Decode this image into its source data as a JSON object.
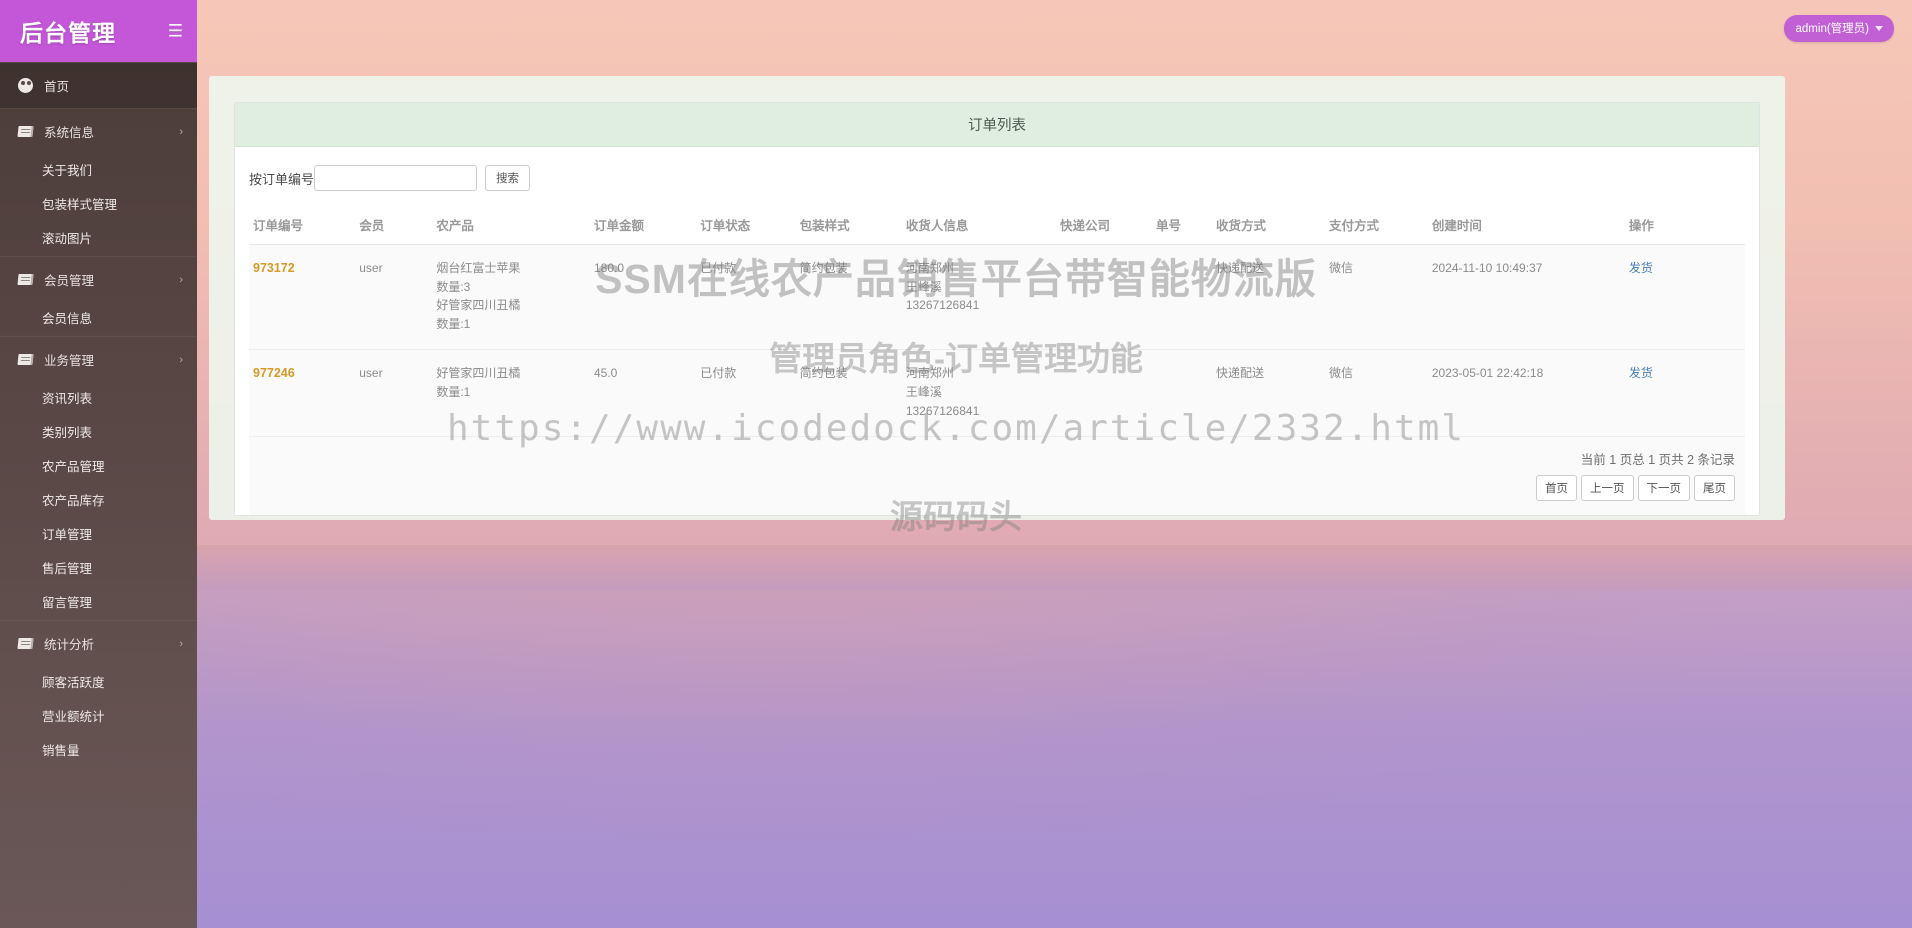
{
  "brand": {
    "title": "后台管理",
    "menu_icon": "hamburger-icon"
  },
  "topbar": {
    "user_label": "admin(管理员)"
  },
  "sidebar": {
    "home": {
      "label": "首页",
      "icon": "dashboard-icon"
    },
    "groups": [
      {
        "label": "系统信息",
        "icon": "book-icon",
        "children": [
          "关于我们",
          "包装样式管理",
          "滚动图片"
        ]
      },
      {
        "label": "会员管理",
        "icon": "book-icon",
        "children": [
          "会员信息"
        ]
      },
      {
        "label": "业务管理",
        "icon": "book-icon",
        "children": [
          "资讯列表",
          "类别列表",
          "农产品管理",
          "农产品库存",
          "订单管理",
          "售后管理",
          "留言管理"
        ]
      },
      {
        "label": "统计分析",
        "icon": "book-icon",
        "children": [
          "顾客活跃度",
          "营业额统计",
          "销售量"
        ]
      }
    ]
  },
  "panel": {
    "title": "订单列表",
    "search": {
      "label": "按订单编号",
      "value": "",
      "placeholder": "",
      "button": "搜索"
    },
    "columns": [
      "订单编号",
      "会员",
      "农产品",
      "订单金额",
      "订单状态",
      "包装样式",
      "收货人信息",
      "快递公司",
      "单号",
      "收货方式",
      "支付方式",
      "创建时间",
      "操作"
    ],
    "rows": [
      {
        "order_no": "973172",
        "member": "user",
        "products": "烟台红富士苹果\n数量:3\n好管家四川丑橘\n数量:1",
        "amount": "180.0",
        "status": "已付款",
        "package": "简约包装",
        "receiver": "河南郑州\n王峰溪\n13267126841",
        "express_company": "",
        "tracking_no": "",
        "delivery": "快递配送",
        "payment": "微信",
        "created": "2024-11-10 10:49:37",
        "action": "发货"
      },
      {
        "order_no": "977246",
        "member": "user",
        "products": "好管家四川丑橘\n数量:1",
        "amount": "45.0",
        "status": "已付款",
        "package": "简约包装",
        "receiver": "河南郑州\n王峰溪\n13267126841",
        "express_company": "",
        "tracking_no": "",
        "delivery": "快递配送",
        "payment": "微信",
        "created": "2023-05-01 22:42:18",
        "action": "发货"
      }
    ],
    "pagination": {
      "info": "当前 1 页总 1 页共 2 条记录",
      "first": "首页",
      "prev": "上一页",
      "next": "下一页",
      "last": "尾页"
    }
  },
  "watermark": {
    "line1": "SSM在线农产品销售平台带智能物流版",
    "line2": "管理员角色-订单管理功能",
    "line3": "https://www.icodedock.com/article/2332.html",
    "line4": "源码码头"
  },
  "colors": {
    "brand_purple": "#c457d8",
    "sidebar_dark": "#54433f",
    "panel_head_green": "#dfeede",
    "order_no_orange": "#d79a27",
    "link_blue": "#4a7fb5"
  }
}
